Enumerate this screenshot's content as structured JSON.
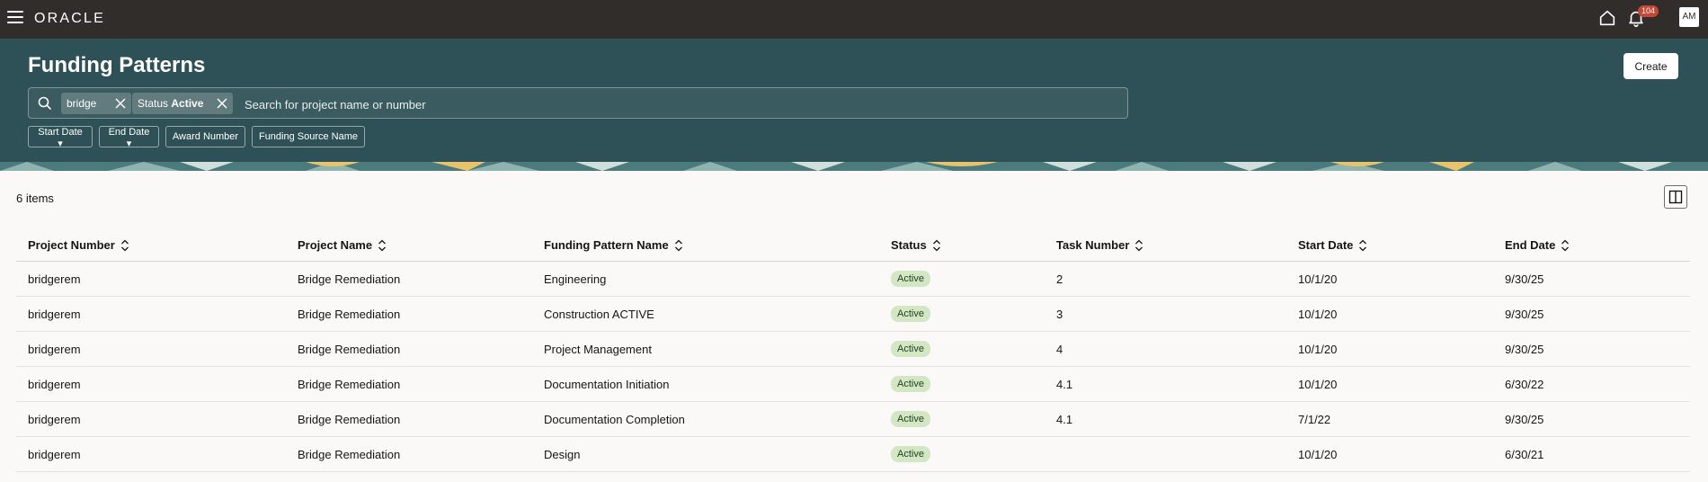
{
  "app": {
    "logo": "ORACLE",
    "notifications": "104",
    "avatar": "AM"
  },
  "header": {
    "title": "Funding Patterns",
    "create_label": "Create",
    "search": {
      "chips": [
        {
          "label": "bridge"
        },
        {
          "prefix": "Status",
          "value": "Active"
        }
      ],
      "placeholder": "Search for project name or number"
    },
    "filters": [
      "Start Date",
      "End Date",
      "Award Number",
      "Funding Source Name"
    ]
  },
  "results": {
    "count": "6 items",
    "columns": [
      "Project Number",
      "Project Name",
      "Funding Pattern Name",
      "Status",
      "Task Number",
      "Start Date",
      "End Date"
    ],
    "rows": [
      {
        "project_number": "bridgerem",
        "project_name": "Bridge Remediation",
        "pattern": "Engineering",
        "status": "Active",
        "task": "2",
        "start": "10/1/20",
        "end": "9/30/25"
      },
      {
        "project_number": "bridgerem",
        "project_name": "Bridge Remediation",
        "pattern": "Construction ACTIVE",
        "status": "Active",
        "task": "3",
        "start": "10/1/20",
        "end": "9/30/25"
      },
      {
        "project_number": "bridgerem",
        "project_name": "Bridge Remediation",
        "pattern": "Project Management",
        "status": "Active",
        "task": "4",
        "start": "10/1/20",
        "end": "9/30/25"
      },
      {
        "project_number": "bridgerem",
        "project_name": "Bridge Remediation",
        "pattern": "Documentation Initiation",
        "status": "Active",
        "task": "4.1",
        "start": "10/1/20",
        "end": "6/30/22"
      },
      {
        "project_number": "bridgerem",
        "project_name": "Bridge Remediation",
        "pattern": "Documentation Completion",
        "status": "Active",
        "task": "4.1",
        "start": "7/1/22",
        "end": "9/30/25"
      },
      {
        "project_number": "bridgerem",
        "project_name": "Bridge Remediation",
        "pattern": "Design",
        "status": "Active",
        "task": "",
        "start": "10/1/20",
        "end": "6/30/21"
      }
    ]
  },
  "icons": {
    "menu": "hamburger-icon",
    "home": "home-icon",
    "bell": "bell-icon",
    "search": "search-icon",
    "clear": "close-icon",
    "sort": "sort-icon",
    "panel": "split-panel-icon"
  },
  "colors": {
    "topbar": "#312d2a",
    "header": "#2e5157",
    "status_bg": "#d4e7c5"
  }
}
